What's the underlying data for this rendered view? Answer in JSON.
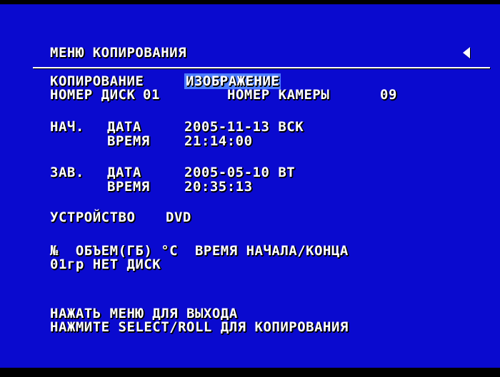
{
  "menu": {
    "title": "МЕНЮ КОПИРОВАНИЯ"
  },
  "copy": {
    "label": "КОПИРОВАНИЕ",
    "value": "ИЗОБРАЖЕНИЕ"
  },
  "disk": {
    "label": "НОМЕР ДИСК",
    "value": "01"
  },
  "camera": {
    "label": "НОМЕР КАМЕРЫ",
    "value": "09"
  },
  "start": {
    "label": "НАЧ.",
    "date_label": "ДАТА",
    "date_value": "2005-11-13 ВСК",
    "time_label": "ВРЕМЯ",
    "time_value": "21:14:00"
  },
  "end": {
    "label": "ЗАВ.",
    "date_label": "ДАТА",
    "date_value": "2005-05-10 ВТ",
    "time_label": "ВРЕМЯ",
    "time_value": "20:35:13"
  },
  "device": {
    "label": "УСТРОЙСТВО",
    "value": "DVD"
  },
  "table": {
    "header": "№  ОБЪЕМ(ГБ) °C  ВРЕМЯ НАЧАЛА/КОНЦА",
    "row": "01гр НЕТ ДИСК"
  },
  "help": {
    "line1": "НАЖАТЬ МЕНЮ ДЛЯ ВЫХОДА",
    "line2": "НАЖМИТЕ SELECT/ROLL ДЛЯ КОПИРОВАНИЯ"
  }
}
